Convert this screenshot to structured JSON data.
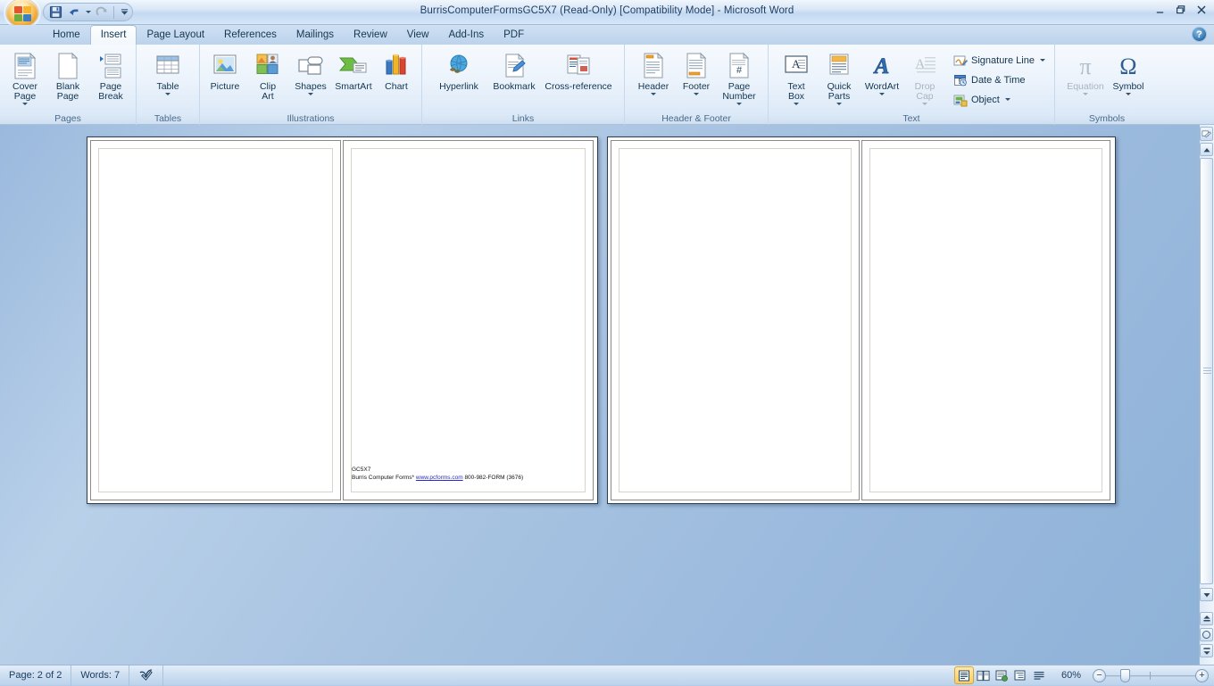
{
  "window": {
    "title": "BurrisComputerFormsGC5X7 (Read-Only) [Compatibility Mode] - Microsoft Word",
    "minimize_label": "–",
    "restore_label": "❐",
    "close_label": "✕",
    "help_label": "?"
  },
  "quick_access": {
    "items": [
      {
        "name": "save-button",
        "label": "Save",
        "icon": "save-icon"
      },
      {
        "name": "undo-button",
        "label": "Undo",
        "icon": "undo-icon"
      },
      {
        "name": "redo-button",
        "label": "Redo",
        "icon": "redo-icon"
      },
      {
        "name": "customize-qat-button",
        "label": "Customize Quick Access Toolbar",
        "icon": "chevron-down-icon"
      }
    ]
  },
  "ribbon": {
    "tabs": [
      {
        "label": "Home",
        "active": false
      },
      {
        "label": "Insert",
        "active": true
      },
      {
        "label": "Page Layout",
        "active": false
      },
      {
        "label": "References",
        "active": false
      },
      {
        "label": "Mailings",
        "active": false
      },
      {
        "label": "Review",
        "active": false
      },
      {
        "label": "View",
        "active": false
      },
      {
        "label": "Add-Ins",
        "active": false
      },
      {
        "label": "PDF",
        "active": false
      }
    ],
    "groups": [
      {
        "label": "Pages",
        "buttons": [
          {
            "label": "Cover\nPage",
            "dropdown": true,
            "disabled": false
          },
          {
            "label": "Blank\nPage",
            "dropdown": false,
            "disabled": false
          },
          {
            "label": "Page\nBreak",
            "dropdown": false,
            "disabled": false
          }
        ]
      },
      {
        "label": "Tables",
        "buttons": [
          {
            "label": "Table",
            "dropdown": true,
            "disabled": false
          }
        ]
      },
      {
        "label": "Illustrations",
        "buttons": [
          {
            "label": "Picture",
            "dropdown": false,
            "disabled": false
          },
          {
            "label": "Clip\nArt",
            "dropdown": false,
            "disabled": false
          },
          {
            "label": "Shapes",
            "dropdown": true,
            "disabled": false
          },
          {
            "label": "SmartArt",
            "dropdown": false,
            "disabled": false
          },
          {
            "label": "Chart",
            "dropdown": false,
            "disabled": false
          }
        ]
      },
      {
        "label": "Links",
        "buttons": [
          {
            "label": "Hyperlink",
            "dropdown": false,
            "disabled": false
          },
          {
            "label": "Bookmark",
            "dropdown": false,
            "disabled": false
          },
          {
            "label": "Cross-reference",
            "dropdown": false,
            "disabled": false
          }
        ]
      },
      {
        "label": "Header & Footer",
        "buttons": [
          {
            "label": "Header",
            "dropdown": true,
            "disabled": false
          },
          {
            "label": "Footer",
            "dropdown": true,
            "disabled": false
          },
          {
            "label": "Page\nNumber",
            "dropdown": true,
            "disabled": false
          }
        ]
      },
      {
        "label": "Text",
        "buttons": [
          {
            "label": "Text\nBox",
            "dropdown": true,
            "disabled": false
          },
          {
            "label": "Quick\nParts",
            "dropdown": true,
            "disabled": false
          },
          {
            "label": "WordArt",
            "dropdown": true,
            "disabled": false
          },
          {
            "label": "Drop\nCap",
            "dropdown": true,
            "disabled": true
          }
        ],
        "small_buttons": [
          {
            "label": "Signature Line",
            "icon": "signature-line-icon",
            "dropdown": true
          },
          {
            "label": "Date & Time",
            "icon": "date-time-icon",
            "dropdown": false
          },
          {
            "label": "Object",
            "icon": "object-icon",
            "dropdown": true
          }
        ]
      },
      {
        "label": "Symbols",
        "buttons": [
          {
            "label": "Equation",
            "dropdown": true,
            "disabled": true,
            "glyph": "π"
          },
          {
            "label": "Symbol",
            "dropdown": true,
            "disabled": false,
            "glyph": "Ω"
          }
        ]
      }
    ]
  },
  "document": {
    "footer_line1": "GC5X7",
    "footer_company": "Burris Computer Forms*",
    "footer_link": "www.pcforms.com",
    "footer_phone": "800-982-FORM (3676)"
  },
  "status_bar": {
    "page": "Page: 2 of 2",
    "words": "Words: 7",
    "proofing_icon": "spelling-check-icon",
    "zoom_level": "60%",
    "zoom_out_label": "−",
    "zoom_in_label": "+",
    "views": [
      {
        "name": "print-layout-view",
        "label": "Print Layout",
        "active": true
      },
      {
        "name": "full-screen-reading-view",
        "label": "Full Screen Reading",
        "active": false
      },
      {
        "name": "web-layout-view",
        "label": "Web Layout",
        "active": false
      },
      {
        "name": "outline-view",
        "label": "Outline",
        "active": false
      },
      {
        "name": "draft-view",
        "label": "Draft",
        "active": false
      }
    ]
  },
  "scrollbar": {
    "browse_object_label": "Select Browse Object",
    "up_label": "▲",
    "down_label": "▼",
    "previous_page_label": "⬆",
    "next_page_label": "⬇"
  }
}
